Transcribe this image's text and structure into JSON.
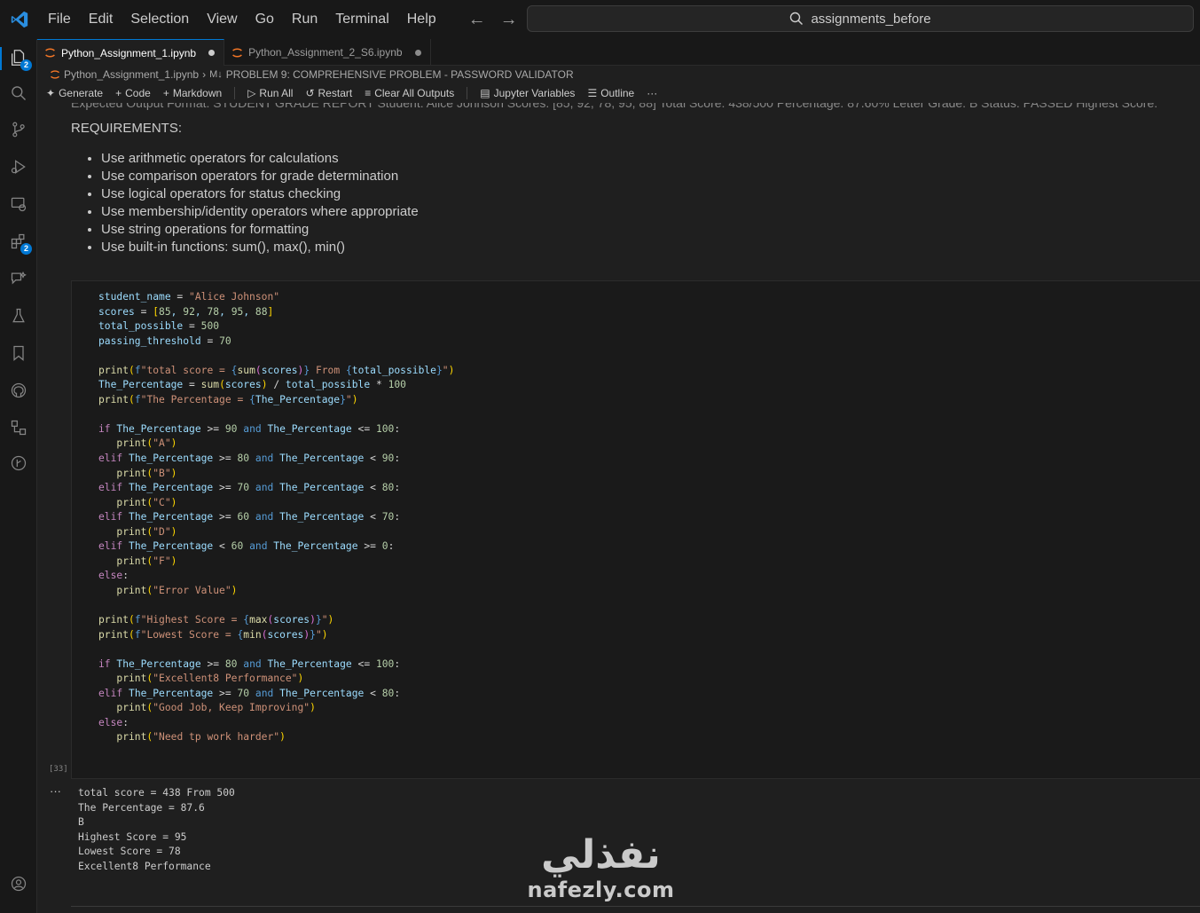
{
  "menu": [
    "File",
    "Edit",
    "Selection",
    "View",
    "Go",
    "Run",
    "Terminal",
    "Help"
  ],
  "search": {
    "text": "assignments_before"
  },
  "activity_badges": {
    "explorer": "2",
    "extensions": "2"
  },
  "tabs": [
    {
      "label": "Python_Assignment_1.ipynb"
    },
    {
      "label": "Python_Assignment_2_S6.ipynb"
    }
  ],
  "breadcrumb": {
    "file": "Python_Assignment_1.ipynb",
    "section": "PROBLEM 9: COMPREHENSIVE PROBLEM - PASSWORD VALIDATOR"
  },
  "toolbar": {
    "generate": "Generate",
    "code": "Code",
    "markdown": "Markdown",
    "run_all": "Run All",
    "restart": "Restart",
    "clear_outputs": "Clear All Outputs",
    "jupyter_variables": "Jupyter Variables",
    "outline": "Outline",
    "more": "···"
  },
  "markdown_cell": {
    "peek_text": "Expected Output Format:          STUDENT GRADE REPORT          Student: Alice Johnson Scores: [85, 92, 78, 95, 88] Total Score: 438/500 Percentage: 87.60% Letter Grade: B Status: PASSED Highest Score:",
    "heading": "REQUIREMENTS:",
    "items": [
      "Use arithmetic operators for calculations",
      "Use comparison operators for grade determination",
      "Use logical operators for status checking",
      "Use membership/identity operators where appropriate",
      "Use string operations for formatting",
      "Use built-in functions: sum(), max(), min()"
    ]
  },
  "code_cell": {
    "execution_count": "[33]",
    "output_more": "···",
    "output": [
      "total score = 438 From 500",
      "The Percentage = 87.6",
      "B",
      "Highest Score = 95",
      "Lowest Score = 78",
      "Excellent8 Performance"
    ]
  },
  "watermark": {
    "arabic": "نفذلي",
    "latin": "nafezly.com"
  }
}
